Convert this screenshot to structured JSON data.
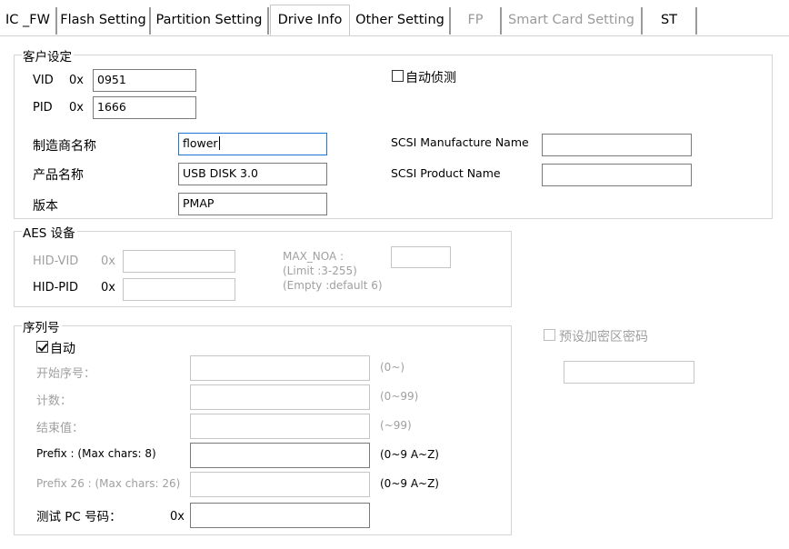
{
  "tabs": [
    {
      "label": "IC _FW",
      "state": "normal"
    },
    {
      "label": "Flash Setting",
      "state": "normal"
    },
    {
      "label": "Partition Setting",
      "state": "normal"
    },
    {
      "label": "Drive Info",
      "state": "active"
    },
    {
      "label": "Other Setting",
      "state": "normal"
    },
    {
      "label": "FP",
      "state": "disabled"
    },
    {
      "label": "Smart Card Setting",
      "state": "disabled"
    },
    {
      "label": "ST",
      "state": "normal"
    }
  ],
  "customer": {
    "legend": "客户设定",
    "vid_label": "VID",
    "vid_prefix": "0x",
    "vid_value": "0951",
    "pid_label": "PID",
    "pid_prefix": "0x",
    "pid_value": "1666",
    "auto_detect_label": "自动侦测",
    "auto_detect_checked": false,
    "manufacturer_label": "制造商名称",
    "manufacturer_value": "flower",
    "product_label": "产品名称",
    "product_value": "USB DISK 3.0",
    "version_label": "版本",
    "version_value": "PMAP",
    "scsi_manufacturer_label": "SCSI Manufacture Name",
    "scsi_manufacturer_value": "",
    "scsi_product_label": "SCSI Product Name",
    "scsi_product_value": ""
  },
  "aes": {
    "legend": "AES 设备",
    "hid_vid_label": "HID-VID",
    "hid_vid_prefix": "0x",
    "hid_vid_value": "",
    "hid_pid_label": "HID-PID",
    "hid_pid_prefix": "0x",
    "hid_pid_value": "",
    "max_noa_line1": "MAX_NOA :",
    "max_noa_line2": "(Limit :3-255)",
    "max_noa_line3": "(Empty :default 6)",
    "max_noa_value": ""
  },
  "serial": {
    "legend": "序列号",
    "auto_label": "自动",
    "auto_checked": true,
    "start_label": "开始序号：",
    "start_value": "",
    "start_hint": "(0~)",
    "count_label": "计数：",
    "count_value": "",
    "count_hint": "(0~99)",
    "end_label": "结束值：",
    "end_value": "",
    "end_hint": "(~99)",
    "prefix_label": "Prefix : (Max chars: 8)",
    "prefix_value": "",
    "prefix_hint": "(0~9 A~Z)",
    "prefix26_label": "Prefix 26 : (Max chars: 26)",
    "prefix26_value": "",
    "prefix26_hint": "(0~9 A~Z)",
    "test_pc_label": "测试 PC 号码：",
    "test_pc_prefix": "0x",
    "test_pc_value": ""
  },
  "secure": {
    "preset_password_label": "预设加密区密码",
    "preset_password_checked": false,
    "preset_password_value": ""
  }
}
